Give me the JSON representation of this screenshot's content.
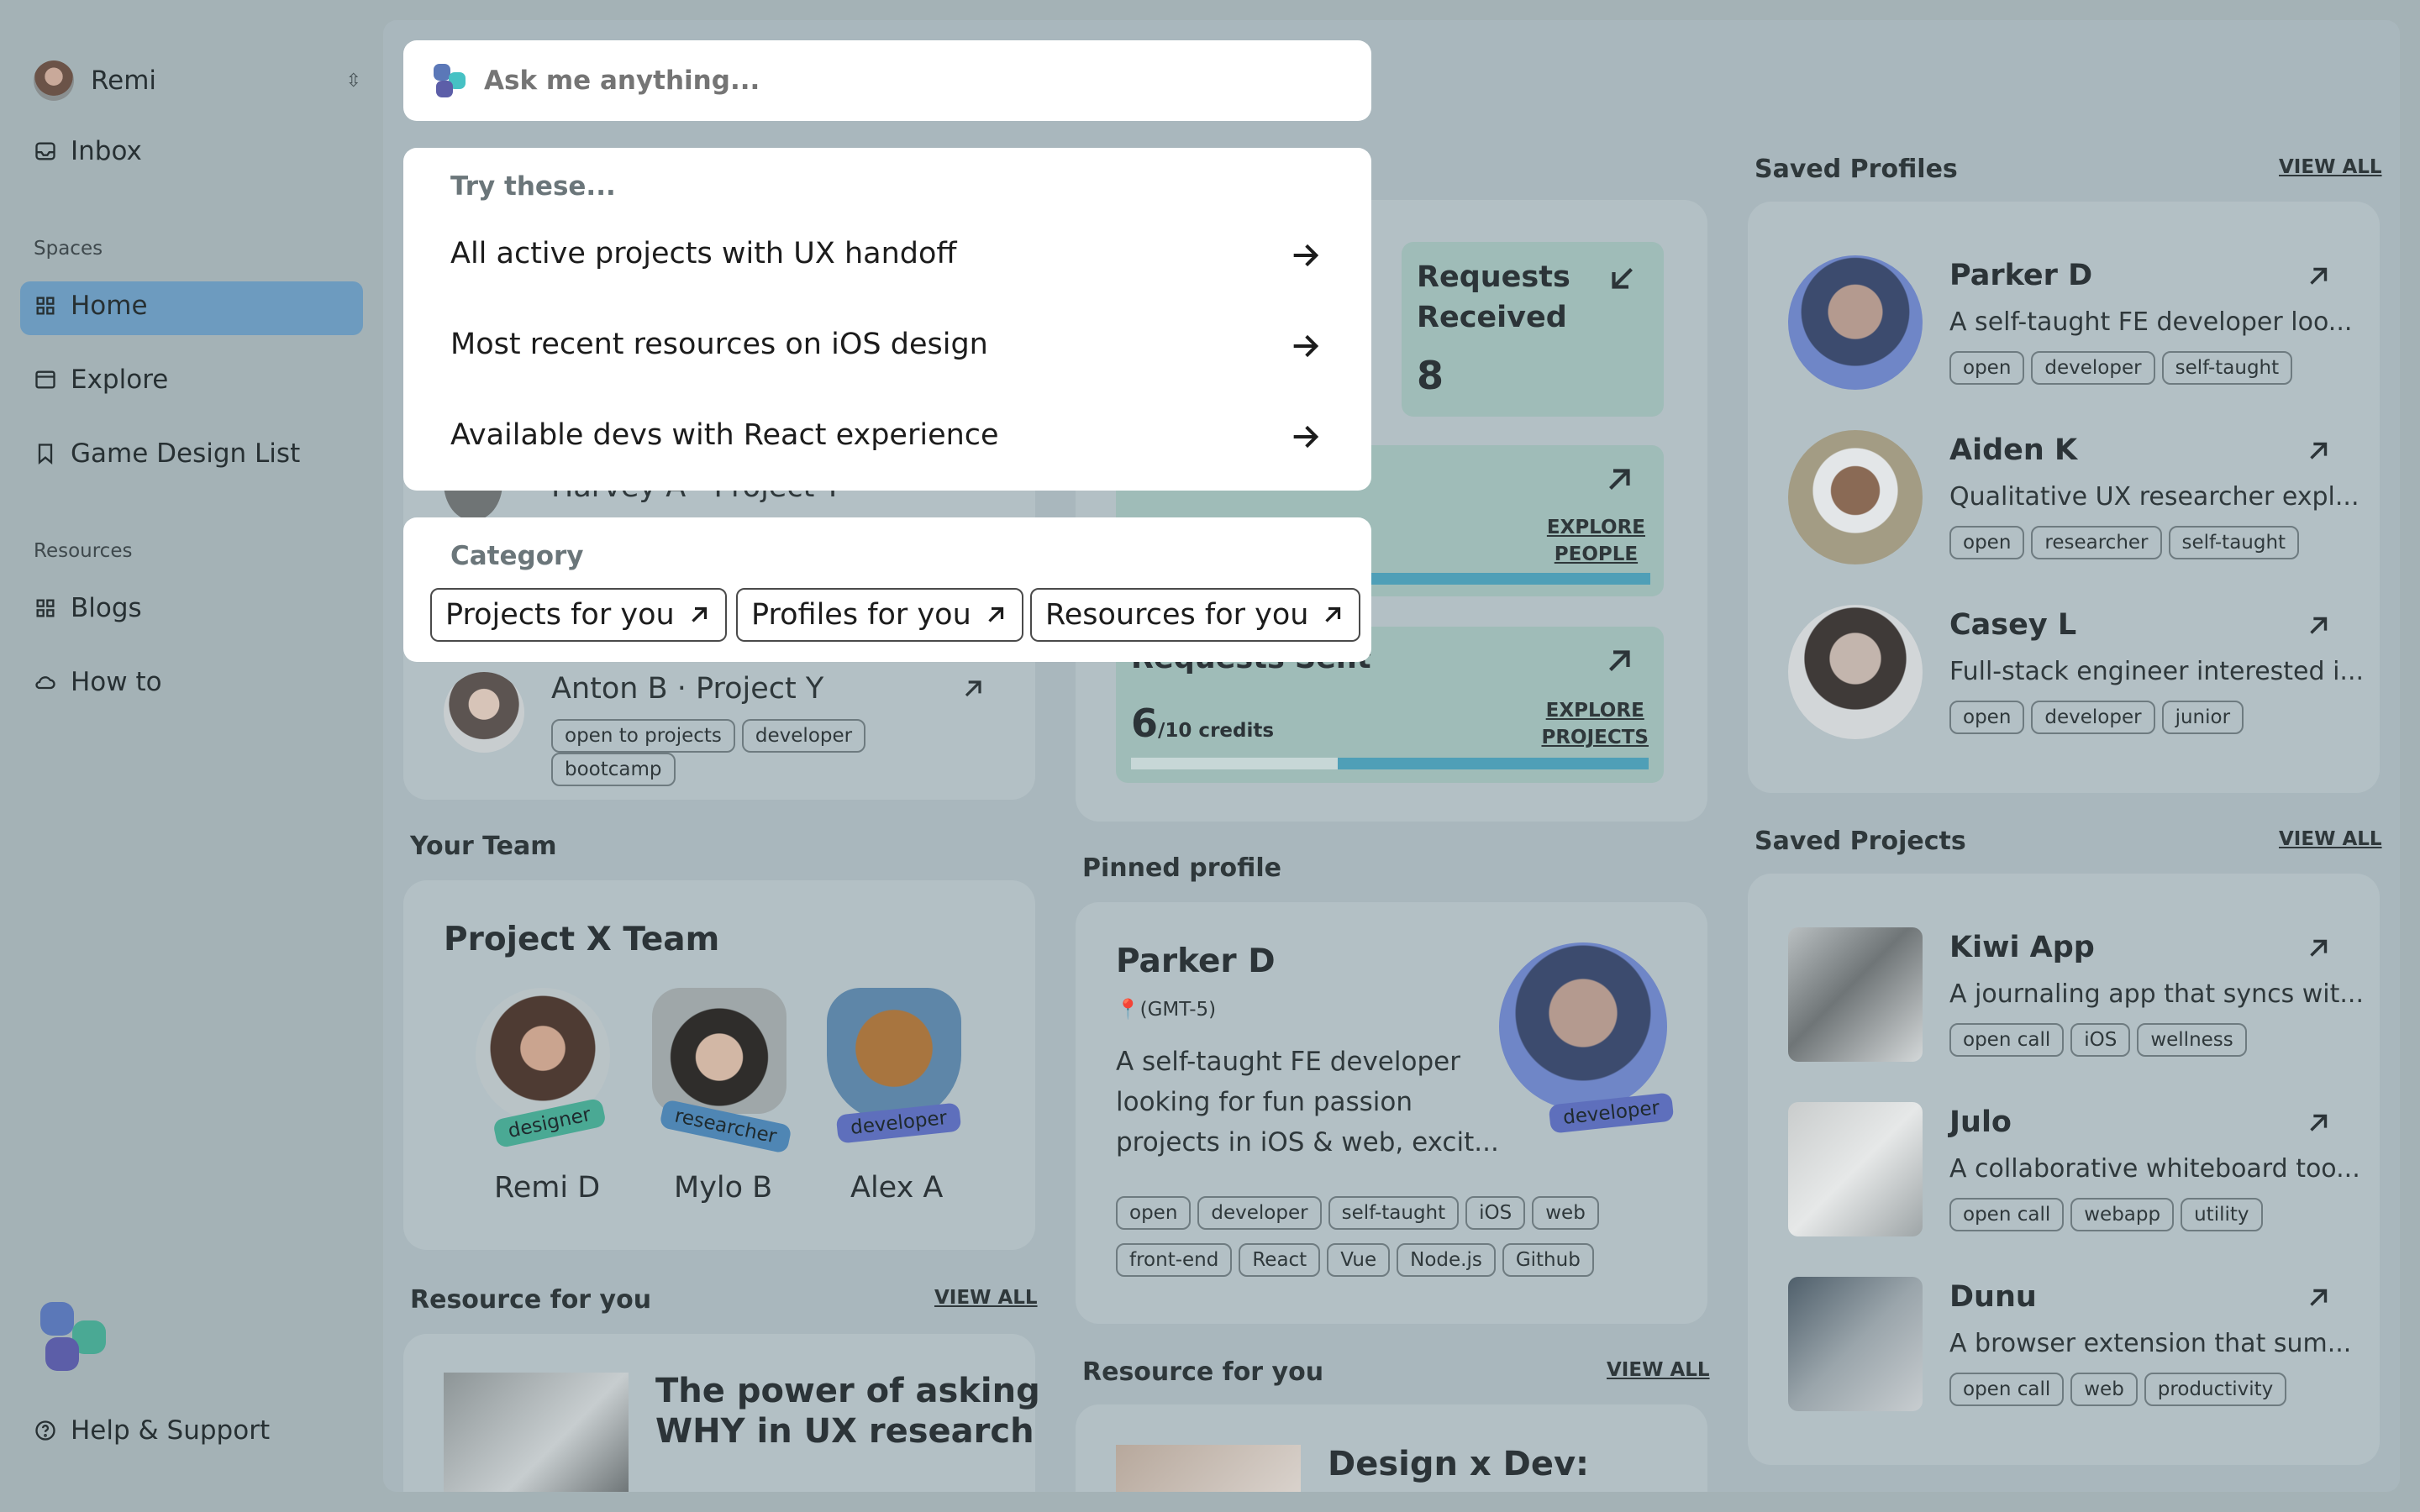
{
  "sidebar": {
    "user_name": "Remi",
    "inbox": "Inbox",
    "spaces_label": "Spaces",
    "spaces": [
      "Home",
      "Explore",
      "Game Design List"
    ],
    "resources_label": "Resources",
    "resources": [
      "Blogs",
      "How to"
    ],
    "help": "Help & Support"
  },
  "search": {
    "placeholder": "Ask me anything..."
  },
  "suggestions": {
    "heading": "Try these...",
    "items": [
      "All active projects with UX handoff",
      "Most recent resources on iOS design",
      "Available devs with React experience"
    ]
  },
  "category": {
    "heading": "Category",
    "buttons": [
      "Projects for you",
      "Profiles for you",
      "Resources for you"
    ]
  },
  "bg_projects": {
    "row1": "Harvey A · Project Y",
    "row2": {
      "title": "Anton B · Project Y",
      "tags": [
        "open to projects",
        "developer",
        "bootcamp"
      ]
    }
  },
  "stats": {
    "received_label": "Requests Received",
    "received_value": "8",
    "explore_people": [
      "EXPLORE",
      "PEOPLE"
    ],
    "sent_label": "Requests Sent",
    "sent_value": "6",
    "sent_suffix": "/10 credits",
    "sent_progress": 0.6,
    "explore_projects": [
      "EXPLORE",
      "PROJECTS"
    ]
  },
  "team": {
    "section": "Your Team",
    "title": "Project X Team",
    "members": [
      {
        "name": "Remi D",
        "role": "designer",
        "color": "#4aa994"
      },
      {
        "name": "Mylo B",
        "role": "researcher",
        "color": "#4f86b4"
      },
      {
        "name": "Alex A",
        "role": "developer",
        "color": "#5e6fbc"
      }
    ]
  },
  "pinned": {
    "section": "Pinned profile",
    "name": "Parker D",
    "tz": "(GMT-5)",
    "desc": [
      "A self-taught FE developer",
      "looking for fun passion",
      "projects in iOS & web, excit..."
    ],
    "role": "developer",
    "tags1": [
      "open",
      "developer",
      "self-taught",
      "iOS",
      "web"
    ],
    "tags2": [
      "front-end",
      "React",
      "Vue",
      "Node.js",
      "Github"
    ]
  },
  "resource_left": {
    "section": "Resource for you",
    "view_all": "VIEW ALL",
    "title": [
      "The power of asking",
      "WHY in UX research"
    ]
  },
  "resource_mid": {
    "section": "Resource for you",
    "view_all": "VIEW ALL",
    "title": "Design x Dev:"
  },
  "saved_profiles": {
    "section": "Saved Profiles",
    "view_all": "VIEW ALL",
    "items": [
      {
        "name": "Parker D",
        "desc": "A self-taught FE developer loo...",
        "tags": [
          "open",
          "developer",
          "self-taught"
        ]
      },
      {
        "name": "Aiden K",
        "desc": "Qualitative UX researcher expl...",
        "tags": [
          "open",
          "researcher",
          "self-taught"
        ]
      },
      {
        "name": "Casey L",
        "desc": "Full-stack engineer interested i...",
        "tags": [
          "open",
          "developer",
          "junior"
        ]
      }
    ]
  },
  "saved_projects": {
    "section": "Saved Projects",
    "view_all": "VIEW ALL",
    "items": [
      {
        "name": "Kiwi App",
        "desc": "A journaling app that syncs wit...",
        "tags": [
          "open call",
          "iOS",
          "wellness"
        ]
      },
      {
        "name": "Julo",
        "desc": "A collaborative whiteboard too...",
        "tags": [
          "open call",
          "webapp",
          "utility"
        ]
      },
      {
        "name": "Dunu",
        "desc": "A browser extension that sum...",
        "tags": [
          "open call",
          "web",
          "productivity"
        ]
      }
    ]
  },
  "colors": {
    "overlay": "#a4b2b6",
    "active_nav": "#6d9bbf",
    "progress": "#4f9fb7"
  }
}
